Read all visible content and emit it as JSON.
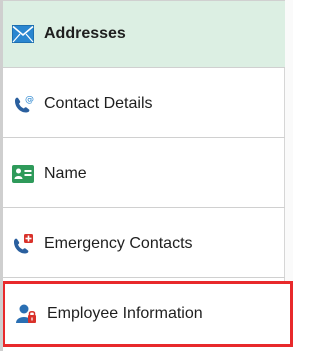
{
  "nav": {
    "items": [
      {
        "label": "Addresses",
        "icon": "envelope-icon",
        "selected": true
      },
      {
        "label": "Contact Details",
        "icon": "phone-at-icon"
      },
      {
        "label": "Name",
        "icon": "id-card-icon"
      },
      {
        "label": "Emergency Contacts",
        "icon": "emergency-phone-icon"
      },
      {
        "label": "Employee Information",
        "icon": "employee-lock-icon",
        "highlighted": true
      }
    ],
    "colors": {
      "selected_bg": "#dcefe3",
      "highlight_border": "#e8292b",
      "icon_blue": "#2a6fb3",
      "icon_green": "#2e8b57",
      "icon_red": "#d9312a"
    }
  }
}
